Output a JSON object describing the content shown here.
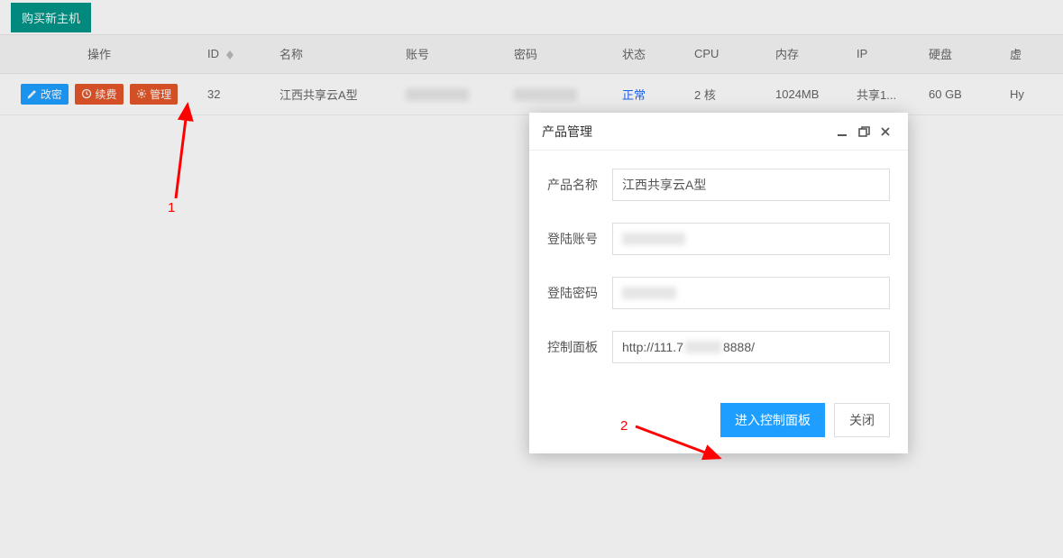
{
  "topbar": {
    "buy_button": "购买新主机"
  },
  "table": {
    "headers": {
      "ops": "操作",
      "id": "ID",
      "name": "名称",
      "account": "账号",
      "password": "密码",
      "status": "状态",
      "cpu": "CPU",
      "memory": "内存",
      "ip": "IP",
      "disk": "硬盘",
      "virt": "虚"
    },
    "row": {
      "ops": {
        "change_pwd": "改密",
        "renew": "续费",
        "manage": "管理"
      },
      "id": "32",
      "name": "江西共享云A型",
      "account": "",
      "password": "",
      "status": "正常",
      "cpu": "2 核",
      "memory": "1024MB",
      "ip": "共享1...",
      "disk": "60 GB",
      "virt": "Hy"
    }
  },
  "annotations": {
    "label1": "1",
    "label2": "2"
  },
  "dialog": {
    "title": "产品管理",
    "fields": {
      "product_name_label": "产品名称",
      "product_name_value": "江西共享云A型",
      "login_account_label": "登陆账号",
      "login_account_value": "",
      "login_password_label": "登陆密码",
      "login_password_value": "",
      "control_panel_label": "控制面板",
      "control_panel_value_prefix": "http://111.7",
      "control_panel_value_suffix": "8888/"
    },
    "buttons": {
      "enter_panel": "进入控制面板",
      "close": "关闭"
    }
  }
}
